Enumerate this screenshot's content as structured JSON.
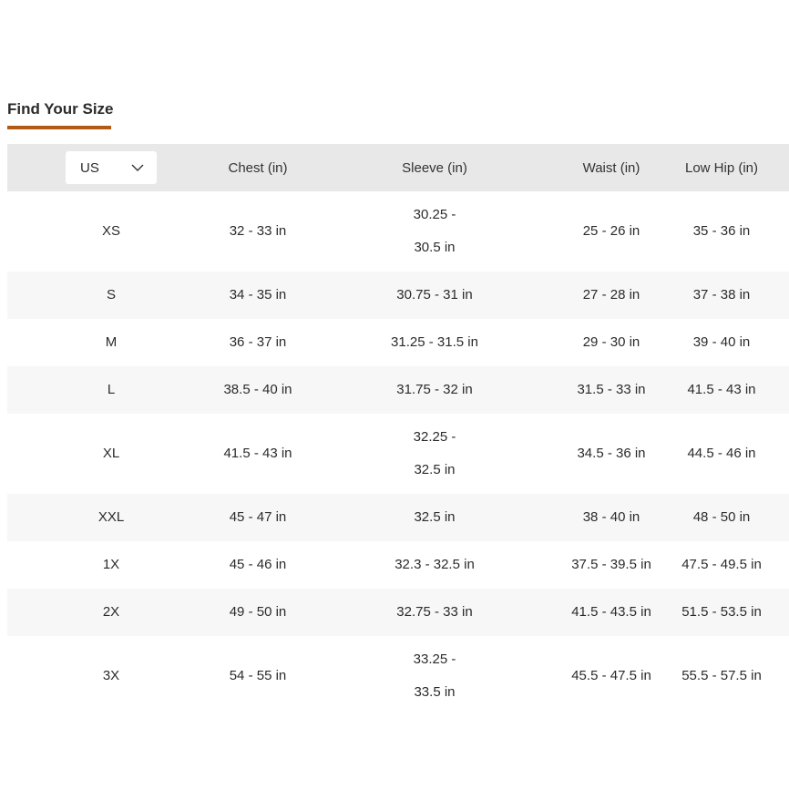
{
  "heading": "Find Your Size",
  "unit_select": {
    "value": "US",
    "icon": "chevron-down-icon"
  },
  "columns": [
    "Chest (in)",
    "Sleeve (in)",
    "Waist (in)",
    "Low Hip (in)"
  ],
  "rows": [
    {
      "size": "XS",
      "chest": "32 - 33 in",
      "sleeve": "30.25 - 30.5 in",
      "waist": "25 - 26 in",
      "hip": "35 - 36 in"
    },
    {
      "size": "S",
      "chest": "34 - 35 in",
      "sleeve": "30.75 - 31 in",
      "waist": "27 - 28 in",
      "hip": "37 - 38 in"
    },
    {
      "size": "M",
      "chest": "36 - 37 in",
      "sleeve": "31.25 - 31.5 in",
      "waist": "29 - 30 in",
      "hip": "39 - 40 in"
    },
    {
      "size": "L",
      "chest": "38.5 - 40 in",
      "sleeve": "31.75 - 32 in",
      "waist": "31.5 - 33 in",
      "hip": "41.5 - 43 in"
    },
    {
      "size": "XL",
      "chest": "41.5 - 43 in",
      "sleeve": "32.25 - 32.5 in",
      "waist": "34.5 - 36 in",
      "hip": "44.5 - 46 in"
    },
    {
      "size": "XXL",
      "chest": "45 - 47 in",
      "sleeve": "32.5 in",
      "waist": "38 - 40 in",
      "hip": "48 - 50 in"
    },
    {
      "size": "1X",
      "chest": "45 - 46 in",
      "sleeve": "32.3 - 32.5 in",
      "waist": "37.5 - 39.5 in",
      "hip": "47.5 - 49.5 in"
    },
    {
      "size": "2X",
      "chest": "49 - 50 in",
      "sleeve": "32.75 - 33 in",
      "waist": "41.5 - 43.5 in",
      "hip": "51.5 - 53.5 in"
    },
    {
      "size": "3X",
      "chest": "54 - 55 in",
      "sleeve": "33.25 - 33.5 in",
      "waist": "45.5 - 47.5 in",
      "hip": "55.5 - 57.5 in"
    }
  ],
  "colors": {
    "accent": "#b05a14",
    "header_bg": "#e8e8e8",
    "stripe_bg": "#f7f7f7"
  }
}
